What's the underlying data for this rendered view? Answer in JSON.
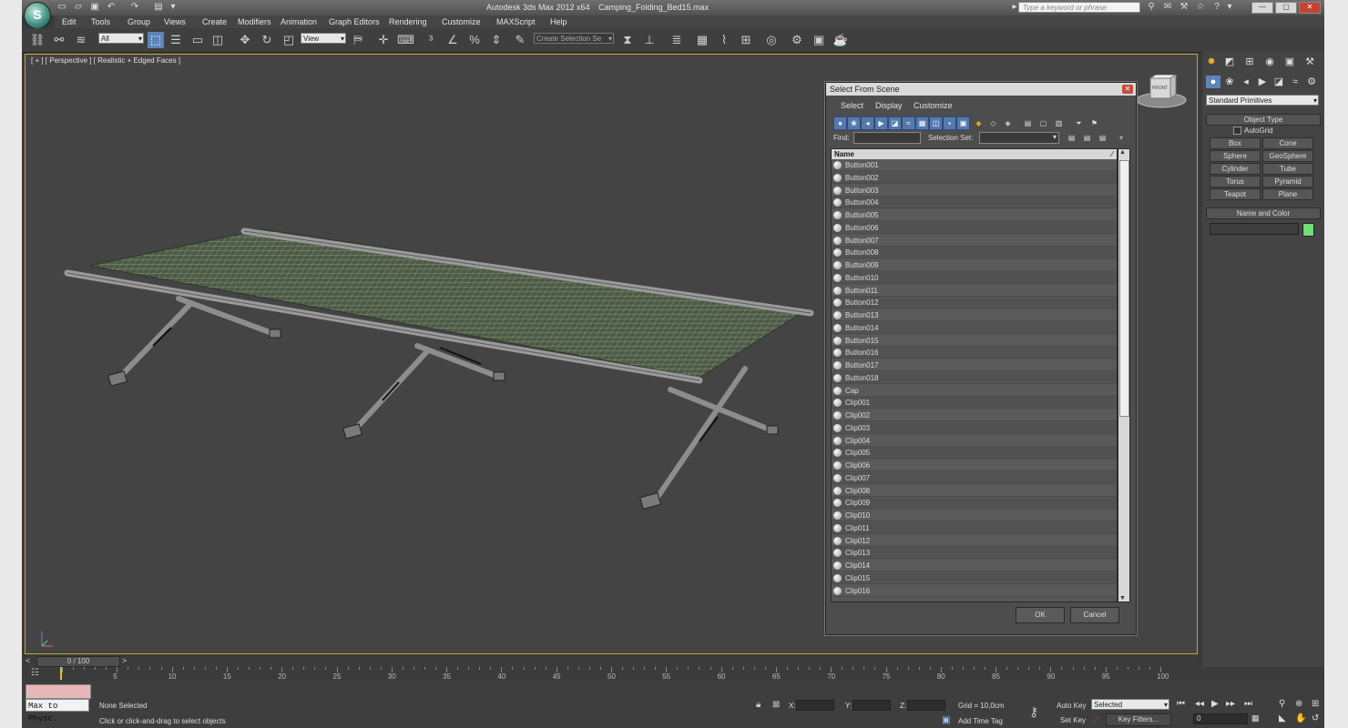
{
  "window": {
    "app_title": "Autodesk 3ds Max  2012 x64",
    "file_name": "Camping_Folding_Bed15.max",
    "search_placeholder": "Type a keyword or phrase"
  },
  "menu": [
    "Edit",
    "Tools",
    "Group",
    "Views",
    "Create",
    "Modifiers",
    "Animation",
    "Graph Editors",
    "Rendering",
    "Customize",
    "MAXScript",
    "Help"
  ],
  "toolbar": {
    "filter_value": "All",
    "ref_coord_value": "View",
    "selection_set_placeholder": "Create Selection Se"
  },
  "viewport": {
    "label": "[ + ] [ Perspective ] [ Realistic + Edged Faces ]",
    "viewcube_label": "FRONT"
  },
  "command_panel": {
    "category": "Standard Primitives",
    "object_type_header": "Object Type",
    "autogrid_label": "AutoGrid",
    "primitives": [
      "Box",
      "Cone",
      "Sphere",
      "GeoSphere",
      "Cylinder",
      "Tube",
      "Torus",
      "Pyramid",
      "Teapot",
      "Plane"
    ],
    "name_color_header": "Name and Color",
    "object_color": "#6fdc76"
  },
  "dialog": {
    "title": "Select From Scene",
    "menu": [
      "Select",
      "Display",
      "Customize"
    ],
    "find_label": "Find:",
    "selection_set_label": "Selection Set:",
    "column_name": "Name",
    "items": [
      "Button001",
      "Button002",
      "Button003",
      "Button004",
      "Button005",
      "Button006",
      "Button007",
      "Button008",
      "Button009",
      "Button010",
      "Button011",
      "Button012",
      "Button013",
      "Button014",
      "Button015",
      "Button016",
      "Button017",
      "Button018",
      "Cap",
      "Clip001",
      "Clip002",
      "Clip003",
      "Clip004",
      "Clip005",
      "Clip006",
      "Clip007",
      "Clip008",
      "Clip009",
      "Clip010",
      "Clip011",
      "Clip012",
      "Clip013",
      "Clip014",
      "Clip015",
      "Clip016"
    ],
    "ok_label": "OK",
    "cancel_label": "Cancel"
  },
  "timeline": {
    "frame_readout": "0 / 100",
    "ticks": [
      "5",
      "10",
      "15",
      "20",
      "25",
      "30",
      "35",
      "40",
      "45",
      "50",
      "55",
      "60",
      "65",
      "70",
      "75",
      "80",
      "85",
      "90",
      "95",
      "100"
    ]
  },
  "status": {
    "maxscript_text": "Max to Physc.",
    "selection_text": "None Selected",
    "prompt_text": "Click or click-and-drag to select objects",
    "x_label": "X:",
    "y_label": "Y:",
    "z_label": "Z:",
    "grid_text": "Grid = 10,0cm",
    "add_time_tag": "Add Time Tag",
    "auto_key": "Auto Key",
    "set_key": "Set Key",
    "key_mode_value": "Selected",
    "key_filters": "Key Filters...",
    "frame_value": "0"
  }
}
